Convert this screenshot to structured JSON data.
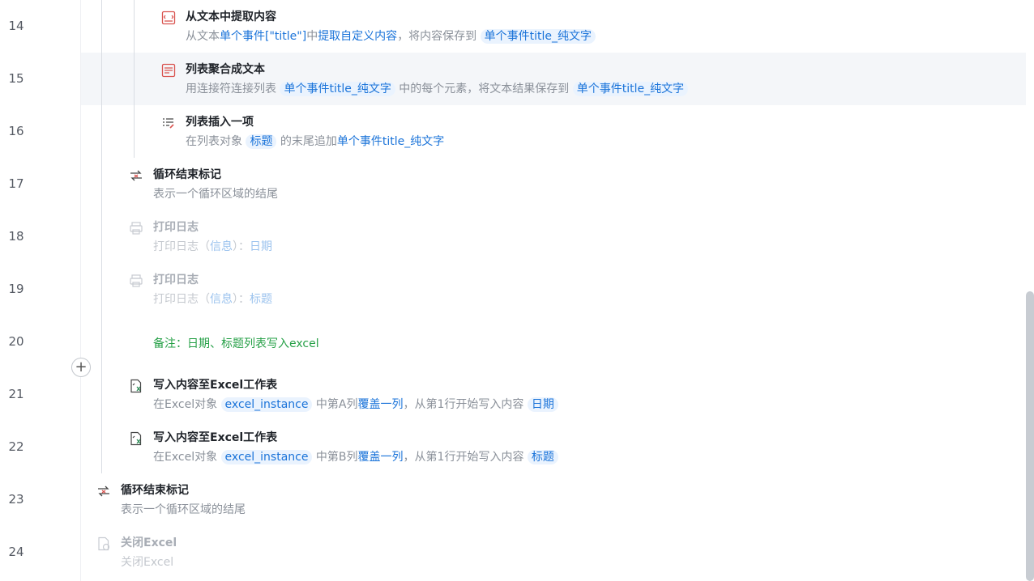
{
  "line_numbers": [
    "14",
    "15",
    "16",
    "17",
    "18",
    "19",
    "20",
    "21",
    "22",
    "23",
    "24"
  ],
  "steps": {
    "extract_text": {
      "title": "从文本中提取内容",
      "d1": "从文本",
      "d2": "单个事件[\"title\"]",
      "d3": "中",
      "d4": "提取自定义内容",
      "d5": "，将内容保存到",
      "d6": "单个事件title_纯文字"
    },
    "join_list": {
      "title": "列表聚合成文本",
      "d1": "用连接符连接列表",
      "d2": "单个事件title_纯文字",
      "d3": "中的每个元素，将文本结果保存到",
      "d4": "单个事件title_纯文字"
    },
    "list_insert": {
      "title": "列表插入一项",
      "d1": "在列表对象",
      "d2": "标题",
      "d3": "的末尾追加",
      "d4": "单个事件title_纯文字"
    },
    "loop_end_inner": {
      "title": "循环结束标记",
      "desc": "表示一个循环区域的结尾"
    },
    "print_log_1": {
      "title": "打印日志",
      "d1": "打印日志（",
      "d2": "信息",
      "d3": "）：",
      "d4": "日期"
    },
    "print_log_2": {
      "title": "打印日志",
      "d1": "打印日志（",
      "d2": "信息",
      "d3": "）：",
      "d4": "标题"
    },
    "note": "备注：日期、标题列表写入excel",
    "write_excel_a": {
      "title": "写入内容至Excel工作表",
      "d1": "在Excel对象",
      "d2": "excel_instance",
      "d3": "中第A列",
      "d4": "覆盖一列",
      "d5": "，从第1行开始写入内容",
      "d6": "日期"
    },
    "write_excel_b": {
      "title": "写入内容至Excel工作表",
      "d1": "在Excel对象",
      "d2": "excel_instance",
      "d3": "中第B列",
      "d4": "覆盖一列",
      "d5": "，从第1行开始写入内容",
      "d6": "标题"
    },
    "loop_end_outer": {
      "title": "循环结束标记",
      "desc": "表示一个循环区域的结尾"
    },
    "close_excel": {
      "title": "关闭Excel",
      "desc": "关闭Excel"
    }
  },
  "add_button": "+",
  "colors": {
    "keyword": "#1a73d9",
    "chip_bg": "#eaf3fe",
    "note": "#26a047",
    "highlight_row": "#f4f6f9"
  }
}
